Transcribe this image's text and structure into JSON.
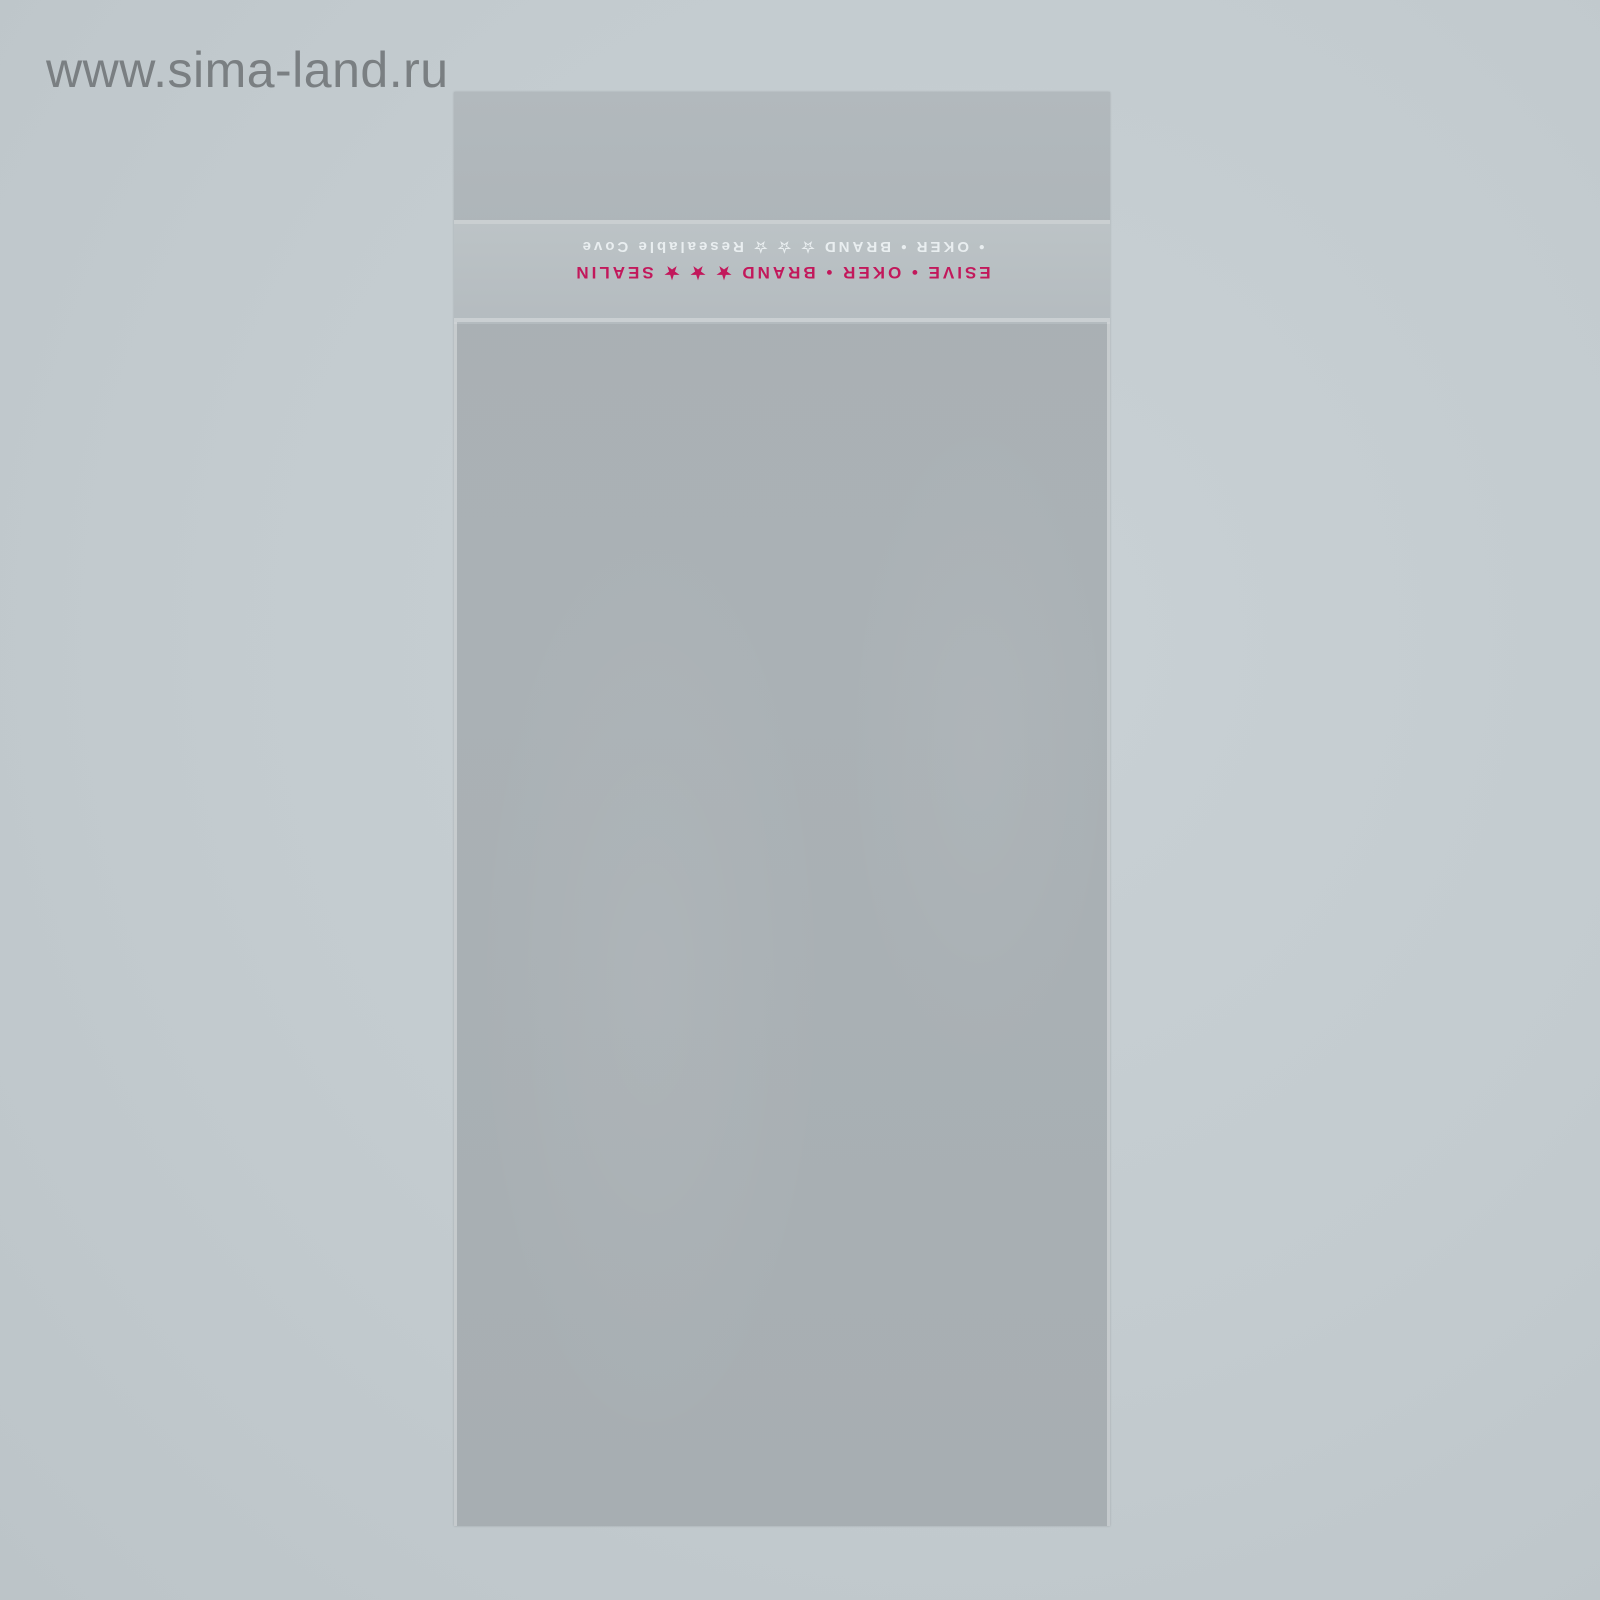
{
  "watermark": {
    "text": "www.sima-land.ru"
  },
  "bag": {
    "tape_white_text": "• OKER • BRAND ☆ ☆ ☆ Resealable Cove",
    "tape_red_text": "ESIVE     • OKER • BRAND ★ ★ ★ SEALIN",
    "colors": {
      "tape_red": "#c2185b",
      "film": "#aab1b5",
      "background": "#c3cbcf"
    }
  }
}
